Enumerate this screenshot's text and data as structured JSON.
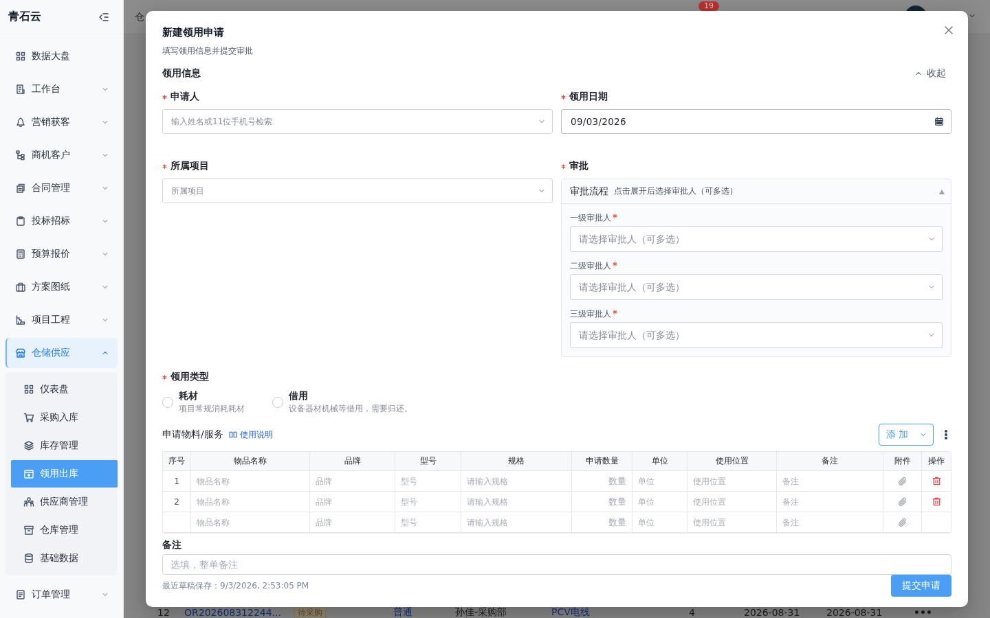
{
  "sidebar": {
    "brand": "青石云",
    "items": [
      {
        "kind": "link",
        "label": "数据大盘",
        "selected": false
      },
      {
        "kind": "group",
        "label": "工作台",
        "selected": false,
        "expanded": false
      },
      {
        "kind": "group",
        "label": "营销获客",
        "selected": false,
        "expanded": false
      },
      {
        "kind": "group",
        "label": "商机客户",
        "selected": false,
        "expanded": false
      },
      {
        "kind": "group",
        "label": "合同管理",
        "selected": false,
        "expanded": false
      },
      {
        "kind": "group",
        "label": "投标招标",
        "selected": false,
        "expanded": false
      },
      {
        "kind": "group",
        "label": "预算报价",
        "selected": false,
        "expanded": false
      },
      {
        "kind": "group",
        "label": "方案图纸",
        "selected": false,
        "expanded": false
      },
      {
        "kind": "group",
        "label": "项目工程",
        "selected": false,
        "expanded": false
      },
      {
        "kind": "group",
        "label": "仓储供应",
        "selected": true,
        "expanded": true,
        "children": [
          {
            "label": "仪表盘",
            "selected": false
          },
          {
            "label": "采购入库",
            "selected": false
          },
          {
            "label": "库存管理",
            "selected": false
          },
          {
            "label": "领用出库",
            "selected": true
          },
          {
            "label": "供应商管理",
            "selected": false
          },
          {
            "label": "仓库管理",
            "selected": false
          },
          {
            "label": "基础数据",
            "selected": false
          }
        ]
      },
      {
        "kind": "group",
        "label": "订单管理",
        "selected": false,
        "expanded": false
      }
    ]
  },
  "topbar": {
    "breadcrumb": "仓",
    "notification_count": "19"
  },
  "page": {
    "row": [
      {
        "kind": "text",
        "text": "12"
      },
      {
        "kind": "link",
        "text": "OR202608312244..."
      },
      {
        "kind": "tag",
        "text": "待采购"
      },
      {
        "kind": "link",
        "text": "普通"
      },
      {
        "kind": "text",
        "text": "孙佳-采购部"
      },
      {
        "kind": "link",
        "text": "PCV电线"
      },
      {
        "kind": "text",
        "text": "4"
      },
      {
        "kind": "text",
        "text": "2026-08-31"
      },
      {
        "kind": "text",
        "text": "2026-08-31"
      },
      {
        "kind": "more",
        "text": "•••"
      }
    ]
  },
  "dialog": {
    "title": "新建领用申请",
    "subtitle": "填写领用信息并提交审批",
    "section": {
      "title": "领用信息",
      "toggle": "收起",
      "expanded": true
    },
    "applicant": {
      "label": "申请人",
      "required": true,
      "placeholder": "输入姓名或11位手机号检索"
    },
    "date": {
      "label": "领用日期",
      "required": true,
      "value": "09/03/2026"
    },
    "project": {
      "label": "所属项目",
      "required": true,
      "placeholder": "所属项目"
    },
    "approval": {
      "label": "审批",
      "required": true,
      "title": "审批流程",
      "hint": "点击展开后选择审批人（可多选）",
      "expanded": true,
      "levels": [
        {
          "label": "一级审批人",
          "required": true,
          "placeholder": "请选择审批人（可多选）"
        },
        {
          "label": "二级审批人",
          "required": true,
          "placeholder": "请选择审批人（可多选）"
        },
        {
          "label": "三级审批人",
          "required": true,
          "placeholder": "请选择审批人（可多选）"
        }
      ]
    },
    "usage_type": {
      "label": "领用类型",
      "required": true,
      "options": [
        {
          "title": "耗材",
          "desc": "项目常规消耗耗材",
          "selected": false
        },
        {
          "title": "借用",
          "desc": "设备器材机械等借用，需要归还。",
          "selected": false
        }
      ]
    },
    "materials": {
      "title": "申请物料/服务",
      "help": "使用说明",
      "add_button": "添 加",
      "columns": [
        "序号",
        "物品名称",
        "品牌",
        "型号",
        "规格",
        "申请数量",
        "单位",
        "使用位置",
        "备注",
        "附件",
        "操作"
      ],
      "rows": [
        {
          "no": "1",
          "deletable": true,
          "cells": [
            {
              "placeholder": "物品名称"
            },
            {
              "placeholder": "品牌"
            },
            {
              "placeholder": "型号"
            },
            {
              "placeholder": "请输入规格"
            },
            {
              "placeholder": "数量"
            },
            {
              "placeholder": "单位"
            },
            {
              "placeholder": "使用位置"
            },
            {
              "placeholder": "备注"
            }
          ]
        },
        {
          "no": "2",
          "deletable": true,
          "cells": [
            {
              "placeholder": "物品名称"
            },
            {
              "placeholder": "品牌"
            },
            {
              "placeholder": "型号"
            },
            {
              "placeholder": "请输入规格"
            },
            {
              "placeholder": "数量"
            },
            {
              "placeholder": "单位"
            },
            {
              "placeholder": "使用位置"
            },
            {
              "placeholder": "备注"
            }
          ]
        },
        {
          "deletable": false,
          "cells": [
            {
              "placeholder": "物品名称"
            },
            {
              "placeholder": "品牌"
            },
            {
              "placeholder": "型号"
            },
            {
              "placeholder": "请输入规格"
            },
            {
              "placeholder": "数量"
            },
            {
              "placeholder": "单位"
            },
            {
              "placeholder": "使用位置"
            },
            {
              "placeholder": "备注"
            }
          ]
        }
      ]
    },
    "remark": {
      "label": "备注",
      "placeholder": "选填，整单备注"
    },
    "saved": "最近草稿保存：9/3/2026, 2:53:05 PM",
    "submit": "提交申请"
  }
}
